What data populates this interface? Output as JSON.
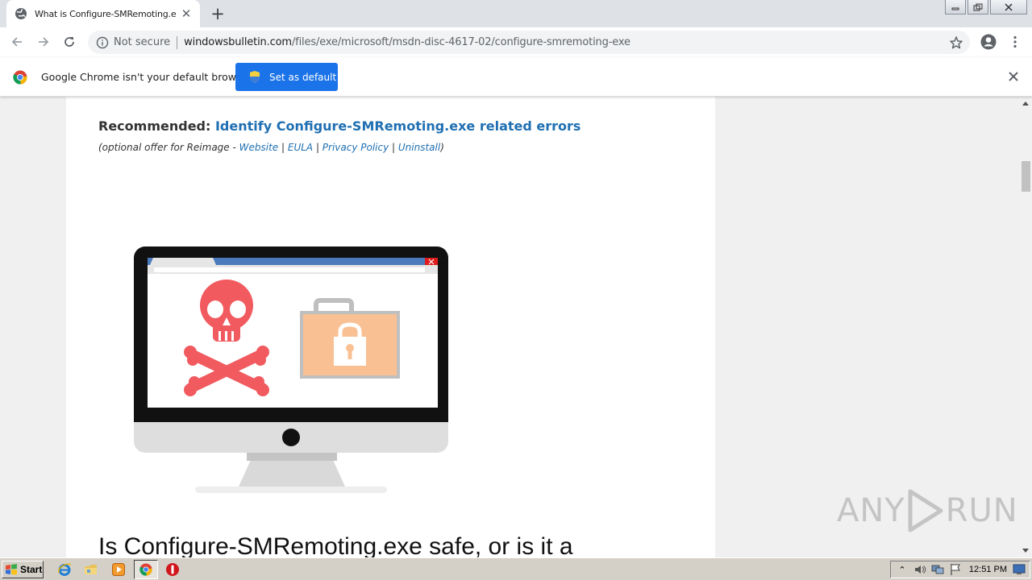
{
  "browser": {
    "tab": {
      "title": "What is Configure-SMRemoting.exe?"
    },
    "omnibox": {
      "security_label": "Not secure",
      "url_host": "windowsbulletin.com",
      "url_path": "/files/exe/microsoft/msdn-disc-4617-02/configure-smremoting-exe"
    },
    "infobar": {
      "message": "Google Chrome isn't your default browser",
      "button_label": "Set as default"
    }
  },
  "page": {
    "recommended_label": "Recommended:",
    "recommended_link": "Identify Configure-SMRemoting.exe related errors",
    "offer_prefix": "(optional offer for Reimage - ",
    "offer_links": [
      "Website",
      "EULA",
      "Privacy Policy",
      "Uninstall"
    ],
    "offer_separator": " | ",
    "offer_suffix": ")",
    "heading": "Is Configure-SMRemoting.exe safe, or is it a"
  },
  "watermark": {
    "left": "ANY",
    "right": "RUN"
  },
  "taskbar": {
    "start_label": "Start",
    "clock": "12:51 PM"
  },
  "colors": {
    "accent_blue": "#1a73e8",
    "link_blue": "#1f6fb2",
    "skull_red": "#f15a5f",
    "folder_orange": "#f9c093"
  }
}
